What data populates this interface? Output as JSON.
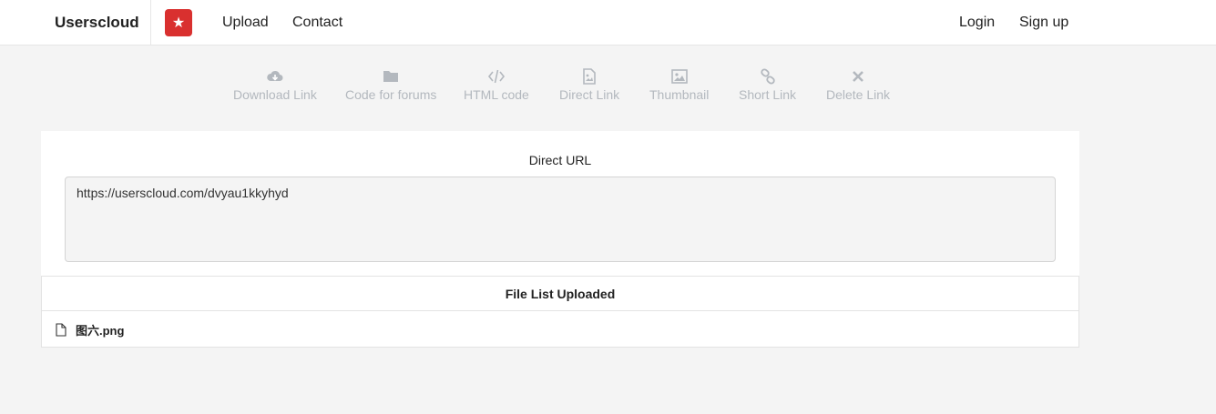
{
  "navbar": {
    "brand": "Userscloud",
    "links": [
      "Upload",
      "Contact"
    ],
    "auth": [
      "Login",
      "Sign up"
    ]
  },
  "toolbar": [
    {
      "label": "Download Link",
      "icon": "cloud-download-icon"
    },
    {
      "label": "Code for forums",
      "icon": "folder-icon"
    },
    {
      "label": "HTML code",
      "icon": "code-icon"
    },
    {
      "label": "Direct Link",
      "icon": "image-file-icon"
    },
    {
      "label": "Thumbnail",
      "icon": "picture-icon"
    },
    {
      "label": "Short Link",
      "icon": "link-icon"
    },
    {
      "label": "Delete Link",
      "icon": "close-icon"
    }
  ],
  "direct_url": {
    "title": "Direct URL",
    "value": "https://userscloud.com/dvyau1kkyhyd\n"
  },
  "file_list": {
    "title": "File List Uploaded",
    "files": [
      "图六.png"
    ]
  },
  "colors": {
    "brand_red": "#d9302f",
    "toolbar_gray": "#b3b8be",
    "page_bg": "#f4f4f4"
  }
}
